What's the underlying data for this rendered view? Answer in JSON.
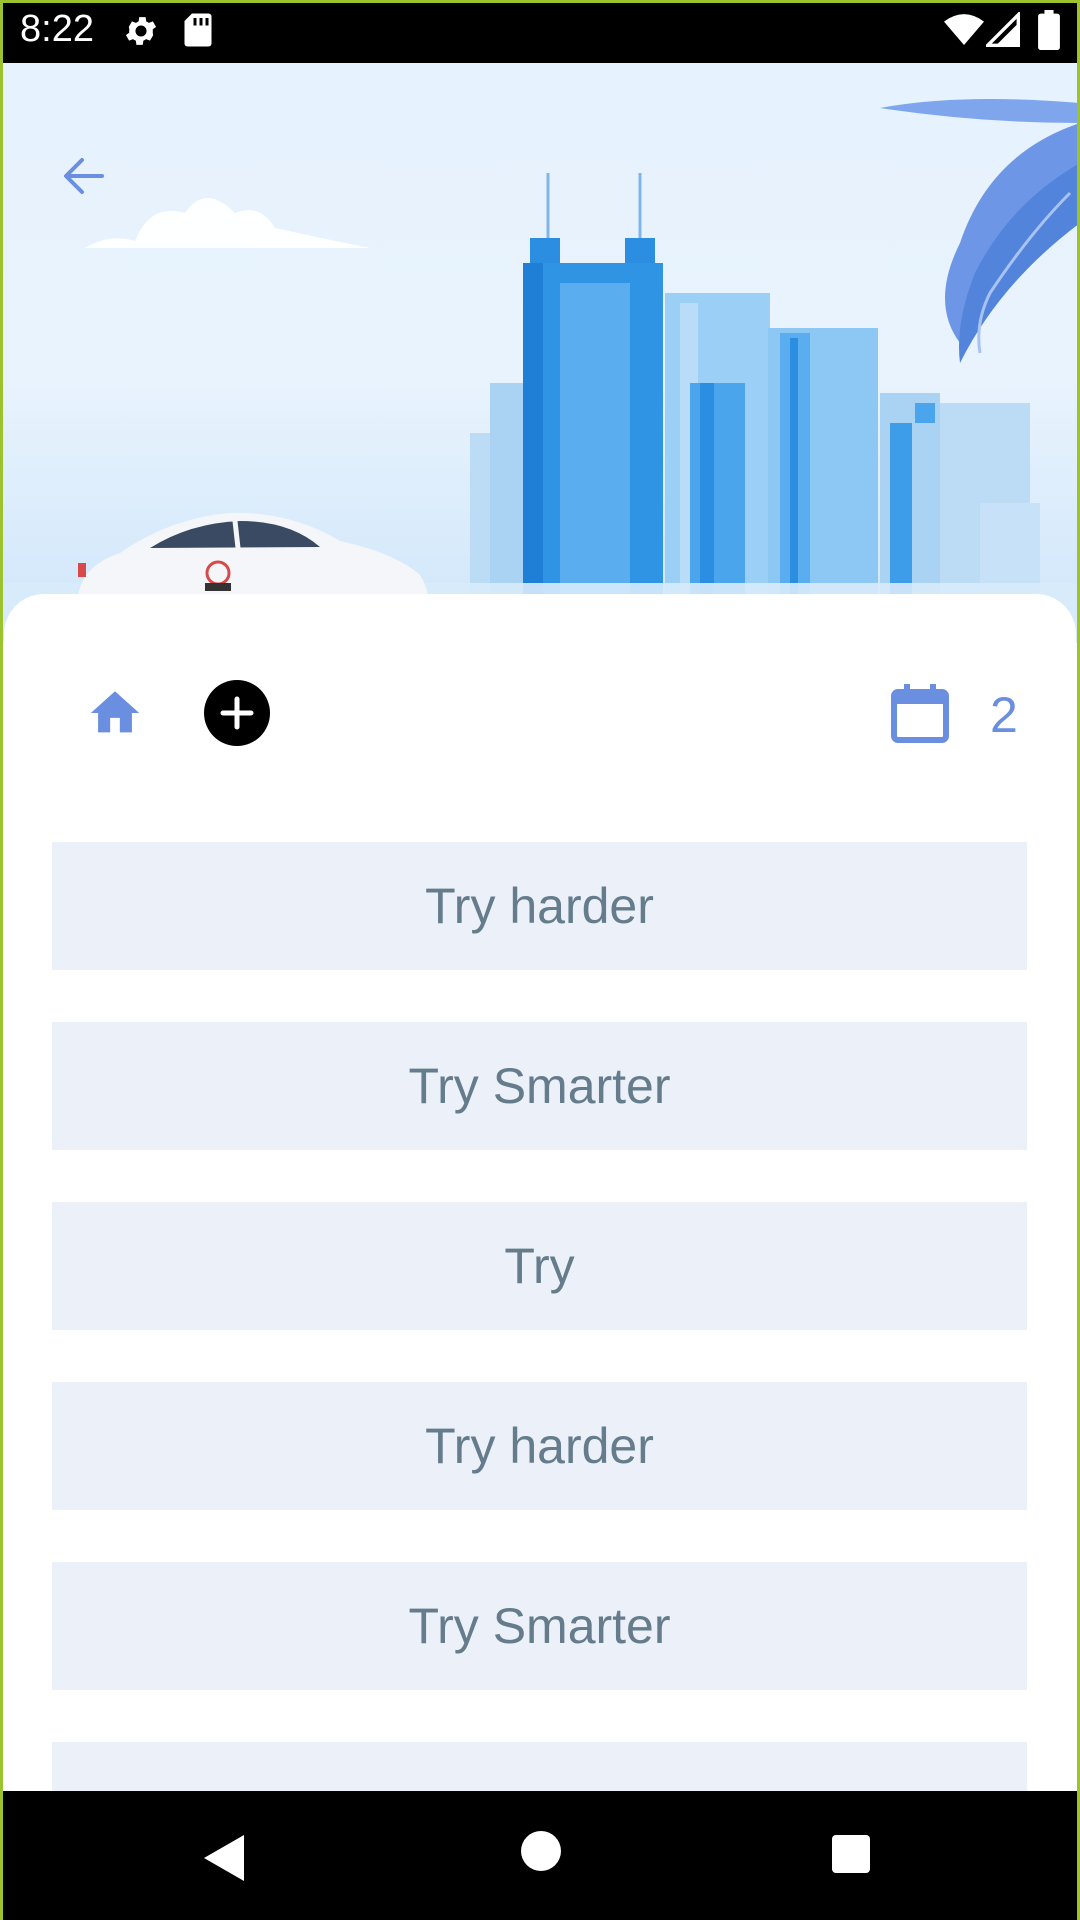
{
  "status_bar": {
    "time": "8:22",
    "icons": [
      "gear-icon",
      "sd-card-icon",
      "wifi-icon",
      "signal-icon",
      "battery-icon"
    ]
  },
  "header": {
    "back_icon": "arrow-left-icon",
    "illustration": "city-skyline-with-car"
  },
  "toolbar": {
    "home_icon": "home-icon",
    "add_icon": "add-circle-icon",
    "calendar_icon": "calendar-icon",
    "count": "2"
  },
  "list": {
    "items": [
      {
        "label": "Try harder"
      },
      {
        "label": "Try Smarter"
      },
      {
        "label": "Try"
      },
      {
        "label": "Try harder"
      },
      {
        "label": "Try Smarter"
      },
      {
        "label": ""
      }
    ]
  },
  "nav_bar": {
    "icons": [
      "nav-back-icon",
      "nav-home-icon",
      "nav-recents-icon"
    ]
  },
  "colors": {
    "accent": "#6a8fe0",
    "item_background": "#ecf0f8",
    "item_text": "#657c8c",
    "frame": "#9cc22e"
  }
}
